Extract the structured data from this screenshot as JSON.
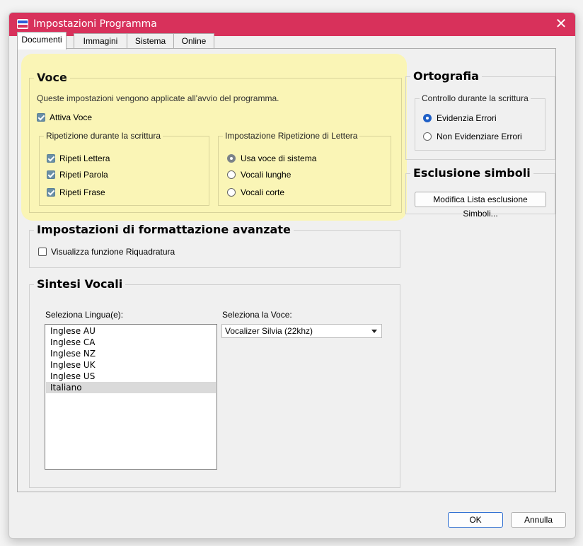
{
  "window": {
    "title": "Impostazioni Programma",
    "close_label": "✕"
  },
  "tabs": [
    {
      "label": "Documenti",
      "active": true
    },
    {
      "label": "Immagini",
      "active": false
    },
    {
      "label": "Sistema",
      "active": false
    },
    {
      "label": "Online",
      "active": false
    }
  ],
  "voce": {
    "title": "Voce",
    "description": "Queste impostazioni vengono applicate all'avvio del programma.",
    "attiva_voce": {
      "label": "Attiva Voce",
      "checked": true
    },
    "ripetizione_group": {
      "title": "Ripetizione durante la scrittura",
      "items": [
        {
          "label": "Ripeti Lettera",
          "checked": true
        },
        {
          "label": "Ripeti Parola",
          "checked": true
        },
        {
          "label": "Ripeti Frase",
          "checked": true
        }
      ]
    },
    "impostazione_group": {
      "title": "Impostazione Ripetizione di Lettera",
      "options": [
        {
          "label": "Usa voce di sistema",
          "selected": true
        },
        {
          "label": "Vocali lunghe",
          "selected": false
        },
        {
          "label": "Vocali corte",
          "selected": false
        }
      ]
    }
  },
  "ortografia": {
    "title": "Ortografia",
    "subgroup_title": "Controllo durante la scrittura",
    "options": [
      {
        "label": "Evidenzia Errori",
        "selected": true
      },
      {
        "label": "Non Evidenziare Errori",
        "selected": false
      }
    ]
  },
  "esclusione": {
    "title": "Esclusione simboli",
    "button_label": "Modifica Lista esclusione Simboli..."
  },
  "formattazione": {
    "title": "Impostazioni di formattazione avanzate",
    "checkbox": {
      "label": "Visualizza funzione Riquadratura",
      "checked": false
    }
  },
  "sintesi": {
    "title": "Sintesi Vocali",
    "lingua_label": "Seleziona Lingua(e):",
    "languages": [
      "Inglese AU",
      "Inglese CA",
      "Inglese NZ",
      "Inglese UK",
      "Inglese US",
      "Italiano"
    ],
    "selected_language": "Italiano",
    "voce_label": "Seleziona la Voce:",
    "voce_value": "Vocalizer Silvia (22khz)"
  },
  "footer": {
    "ok_label": "OK",
    "cancel_label": "Annulla"
  },
  "colors": {
    "titlebar": "#d8315b",
    "highlight": "#faf5b6",
    "accent": "#1f5fc6"
  }
}
